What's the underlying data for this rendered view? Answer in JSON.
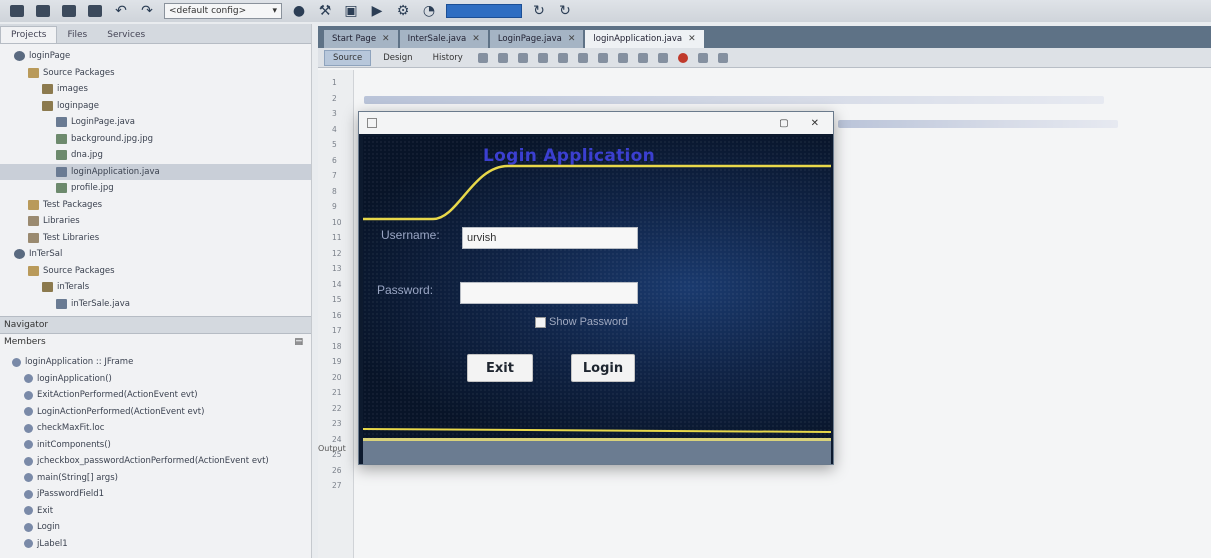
{
  "toolbar": {
    "config_select": "<default config>",
    "icons": [
      "new-file-icon",
      "open-project-icon",
      "save-all-icon",
      "undo-icon",
      "redo-icon",
      "config-select",
      "clean-icon",
      "build-icon",
      "run-icon",
      "debug-icon",
      "profile-icon",
      "search-box",
      "refresh-icon"
    ]
  },
  "projects_panel": {
    "tabs": [
      "Projects",
      "Files",
      "Services"
    ],
    "tree": [
      {
        "label": "loginPage",
        "indent": 1,
        "icon": "proj"
      },
      {
        "label": "Source Packages",
        "indent": 2,
        "icon": "folder"
      },
      {
        "label": "images",
        "indent": 3,
        "icon": "pkg"
      },
      {
        "label": "loginpage",
        "indent": 3,
        "icon": "pkg"
      },
      {
        "label": "LoginPage.java",
        "indent": 4,
        "icon": "java"
      },
      {
        "label": "background.jpg.jpg",
        "indent": 4,
        "icon": "img"
      },
      {
        "label": "dna.jpg",
        "indent": 4,
        "icon": "img"
      },
      {
        "label": "loginApplication.java",
        "indent": 4,
        "icon": "java",
        "selected": true
      },
      {
        "label": "profile.jpg",
        "indent": 4,
        "icon": "img"
      },
      {
        "label": "Test Packages",
        "indent": 2,
        "icon": "folder"
      },
      {
        "label": "Libraries",
        "indent": 2,
        "icon": "lib"
      },
      {
        "label": "Test Libraries",
        "indent": 2,
        "icon": "lib"
      },
      {
        "label": "InTerSal",
        "indent": 1,
        "icon": "proj"
      },
      {
        "label": "Source Packages",
        "indent": 2,
        "icon": "folder"
      },
      {
        "label": "inTerals",
        "indent": 3,
        "icon": "pkg"
      },
      {
        "label": "inTerSale.java",
        "indent": 4,
        "icon": "java"
      }
    ]
  },
  "navigator": {
    "title": "Navigator",
    "members_label": "Members",
    "items": [
      {
        "label": "loginApplication :: JFrame",
        "indent": 1
      },
      {
        "label": "loginApplication()",
        "indent": 2
      },
      {
        "label": "ExitActionPerformed(ActionEvent evt)",
        "indent": 2
      },
      {
        "label": "LoginActionPerformed(ActionEvent evt)",
        "indent": 2
      },
      {
        "label": "checkMaxFit.loc",
        "indent": 2
      },
      {
        "label": "initComponents()",
        "indent": 2
      },
      {
        "label": "jcheckbox_passwordActionPerformed(ActionEvent evt)",
        "indent": 2
      },
      {
        "label": "main(String[] args)",
        "indent": 2
      },
      {
        "label": "jPasswordField1",
        "indent": 2
      },
      {
        "label": "Exit",
        "indent": 2
      },
      {
        "label": "Login",
        "indent": 2
      },
      {
        "label": "jLabel1",
        "indent": 2
      }
    ]
  },
  "editor": {
    "tabs": [
      {
        "label": "Start Page",
        "active": false
      },
      {
        "label": "InterSale.java",
        "active": false
      },
      {
        "label": "LoginPage.java",
        "active": false
      },
      {
        "label": "loginApplication.java",
        "active": true
      }
    ],
    "subtabs": [
      "Source",
      "Design",
      "History"
    ],
    "output_label": "Output"
  },
  "dialog": {
    "app_title": "Login Application",
    "username_label": "Username:",
    "username_value": "urvish",
    "password_label": "Password:",
    "password_value": "",
    "show_password": "Show Password",
    "exit_button": "Exit",
    "login_button": "Login"
  }
}
